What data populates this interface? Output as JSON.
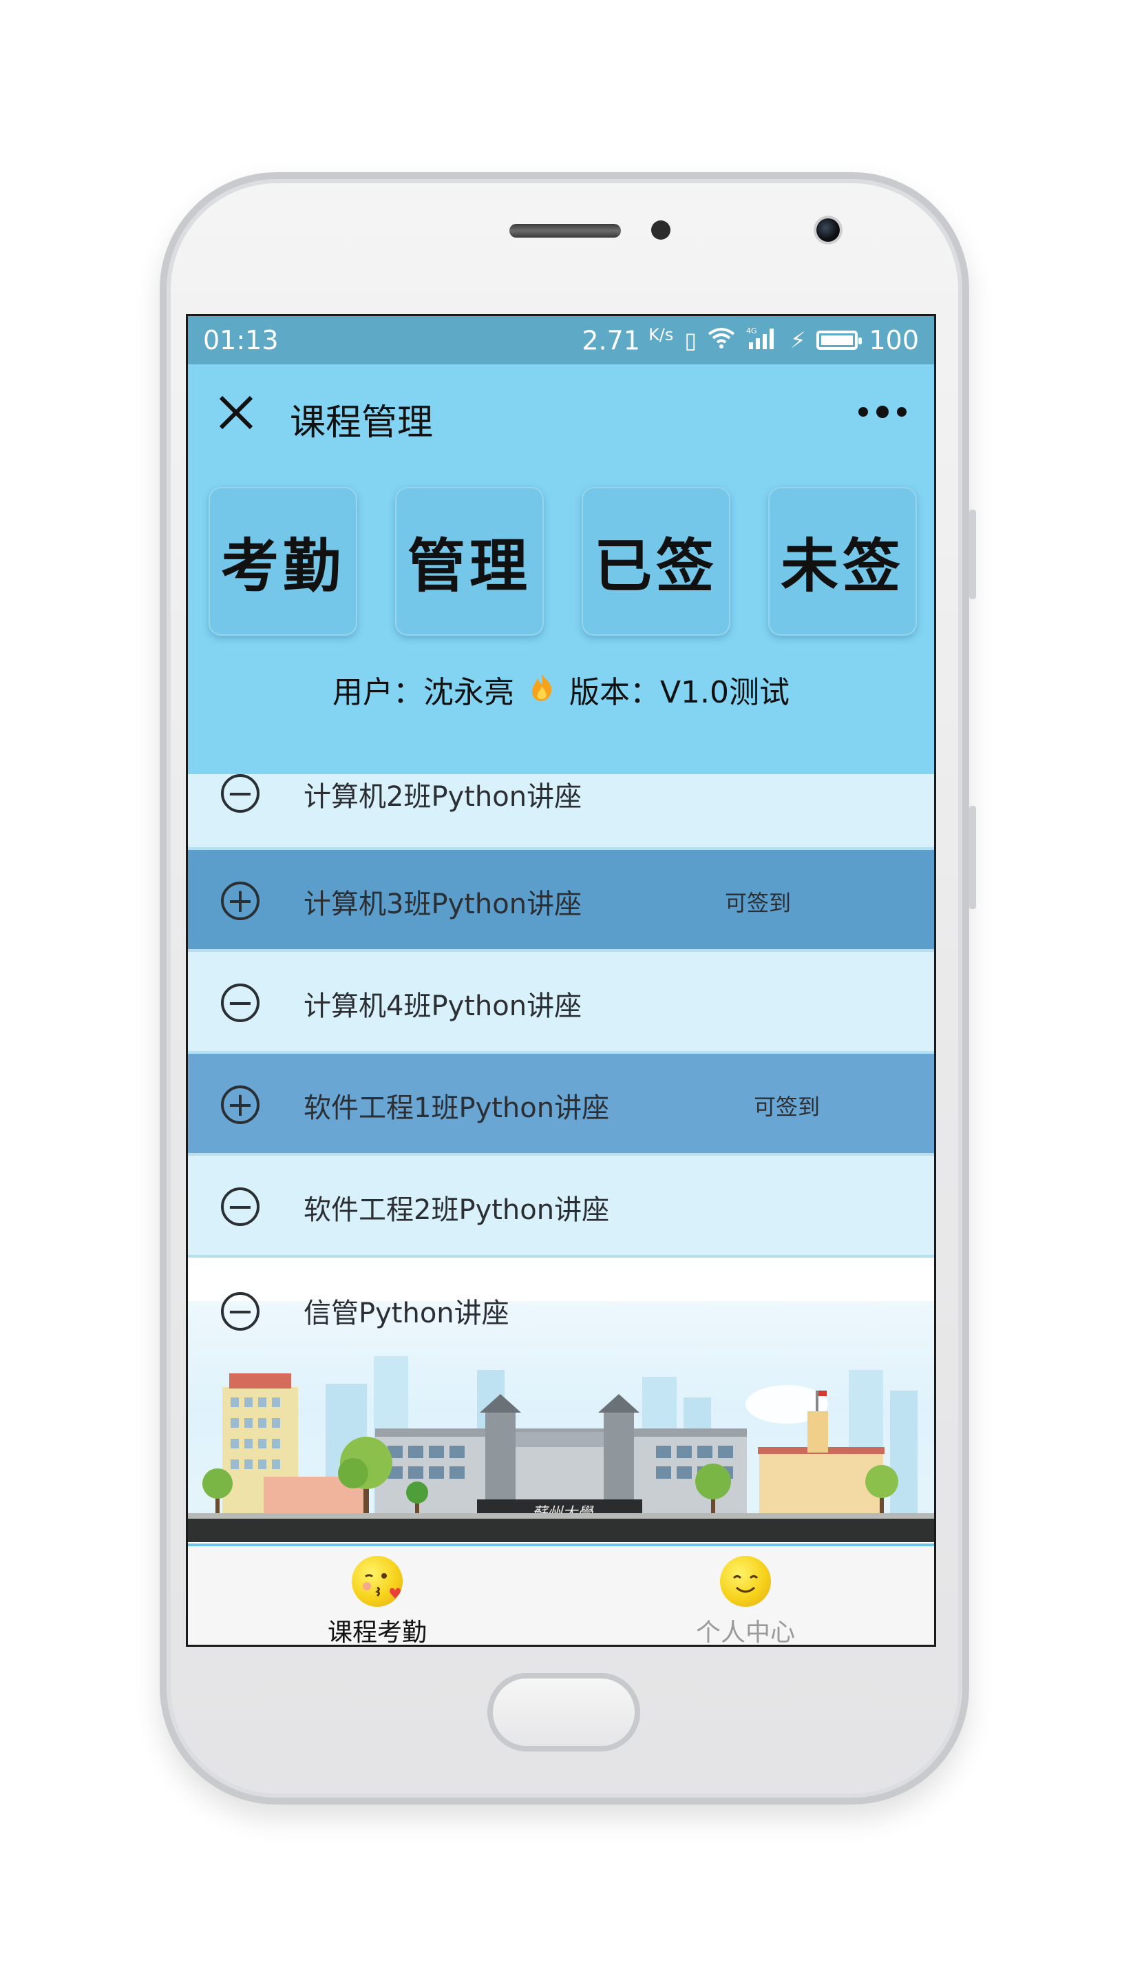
{
  "status_bar": {
    "time": "01:13",
    "speed_value": "2.71",
    "speed_unit": "K/s",
    "network": "4G",
    "battery": "100"
  },
  "nav": {
    "title": "课程管理"
  },
  "tiles": [
    {
      "label": "考勤"
    },
    {
      "label": "管理"
    },
    {
      "label": "已签"
    },
    {
      "label": "未签"
    }
  ],
  "info": {
    "user_label": "用户：",
    "user_name": "沈永亮",
    "version_label": "版本：",
    "version": "V1.0测试"
  },
  "courses": [
    {
      "name": "计算机2班Python讲座",
      "status": "",
      "action": "remove"
    },
    {
      "name": "计算机3班Python讲座",
      "status": "可签到",
      "action": "add"
    },
    {
      "name": "计算机4班Python讲座",
      "status": "",
      "action": "remove"
    },
    {
      "name": "软件工程1班Python讲座",
      "status": "可签到",
      "action": "add"
    },
    {
      "name": "软件工程2班Python讲座",
      "status": "",
      "action": "remove"
    },
    {
      "name": "信管Python讲座",
      "status": "",
      "action": "remove"
    }
  ],
  "tab_bar": {
    "tabs": [
      {
        "label": "课程考勤",
        "active": true
      },
      {
        "label": "个人中心",
        "active": false
      }
    ]
  },
  "colors": {
    "header_bg": "#83d3f3",
    "status_bg": "#5ea9c6",
    "row_light": "#d9f1fa",
    "row_dark": "#5b9ecc",
    "accent": "#6cc6e8"
  }
}
